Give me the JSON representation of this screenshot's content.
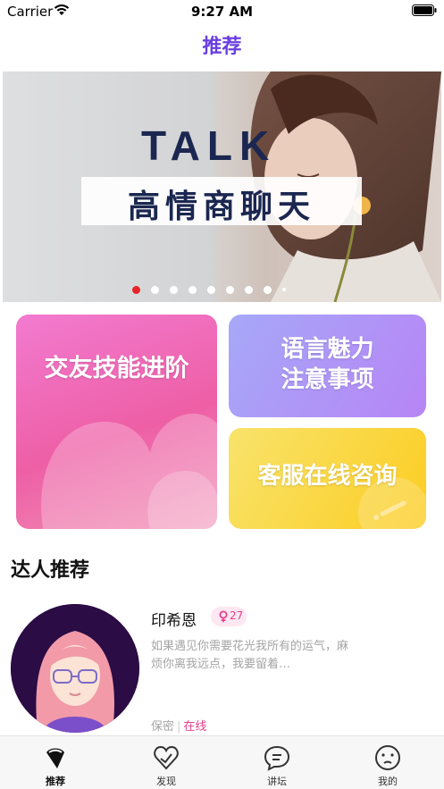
{
  "status_bar": {
    "carrier": "Carrier",
    "time": "9:27 AM"
  },
  "nav": {
    "title": "推荐"
  },
  "banner": {
    "headline": "TALK",
    "caption": "高情商聊天",
    "page_count": 9,
    "active_page": 0
  },
  "cards": {
    "skills": "交友技能进阶",
    "language_line1": "语言魅力",
    "language_line2": "注意事项",
    "service": "客服在线咨询"
  },
  "section": {
    "title": "达人推荐"
  },
  "expert": {
    "name": "印希恩",
    "age": "27",
    "bio": "如果遇见你需要花光我所有的运气，麻烦你离我远点，我要留着…",
    "privacy": "保密",
    "separator": "|",
    "online": "在线"
  },
  "tabs": [
    {
      "label": "推荐",
      "icon": "recommend-icon",
      "active": true
    },
    {
      "label": "发现",
      "icon": "discover-icon",
      "active": false
    },
    {
      "label": "讲坛",
      "icon": "forum-icon",
      "active": false
    },
    {
      "label": "我的",
      "icon": "profile-icon",
      "active": false
    }
  ],
  "colors": {
    "accent": "#6a3fe0",
    "pink": "#e83e8c",
    "active_dot": "#e8242a"
  }
}
